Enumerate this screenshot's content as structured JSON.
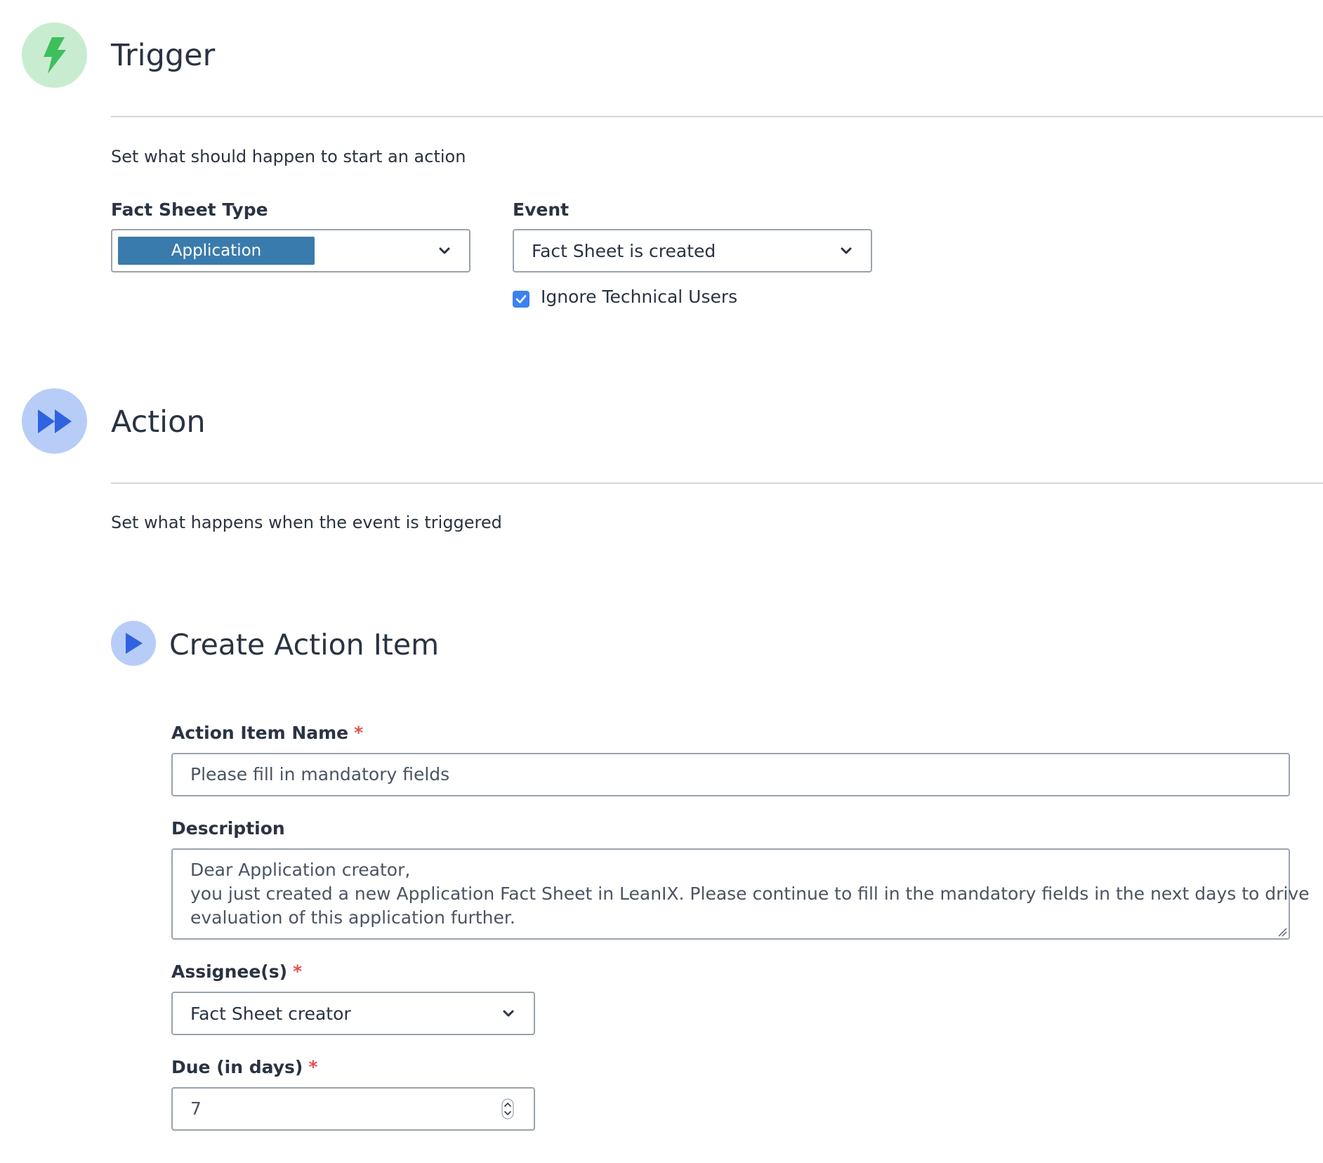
{
  "trigger": {
    "title": "Trigger",
    "icon": "lightning-bolt-icon",
    "subtitle": "Set what should happen to start an action",
    "fact_sheet_type": {
      "label": "Fact Sheet Type",
      "selected_tag": "Application"
    },
    "event": {
      "label": "Event",
      "selected": "Fact Sheet is created"
    },
    "ignore_technical_users": {
      "label": "Ignore Technical Users",
      "checked": true
    }
  },
  "action": {
    "title": "Action",
    "icon": "fast-forward-icon",
    "subtitle": "Set what happens when the event is triggered"
  },
  "create_action_item": {
    "title": "Create Action Item",
    "icon": "play-icon",
    "name": {
      "label": "Action Item Name",
      "value": "Please fill in mandatory fields"
    },
    "description": {
      "label": "Description",
      "line1": "Dear Application creator,",
      "line2": "you just created a new Application Fact Sheet in LeanIX. Please continue to fill in the mandatory fields in the next days to drive",
      "line3": "evaluation of this application further."
    },
    "assignees": {
      "label": "Assignee(s)",
      "selected": "Fact Sheet creator"
    },
    "due": {
      "label": "Due (in days)",
      "value": "7"
    },
    "required_marker": "*"
  },
  "colors": {
    "trigger_circle": "#c8ecd0",
    "trigger_bolt": "#3fbf5c",
    "action_circle": "#b7cdf7",
    "action_glyph": "#2f63df",
    "tag_chip": "#3a7bad",
    "checkbox": "#3b82f0",
    "required": "#e0524e"
  }
}
